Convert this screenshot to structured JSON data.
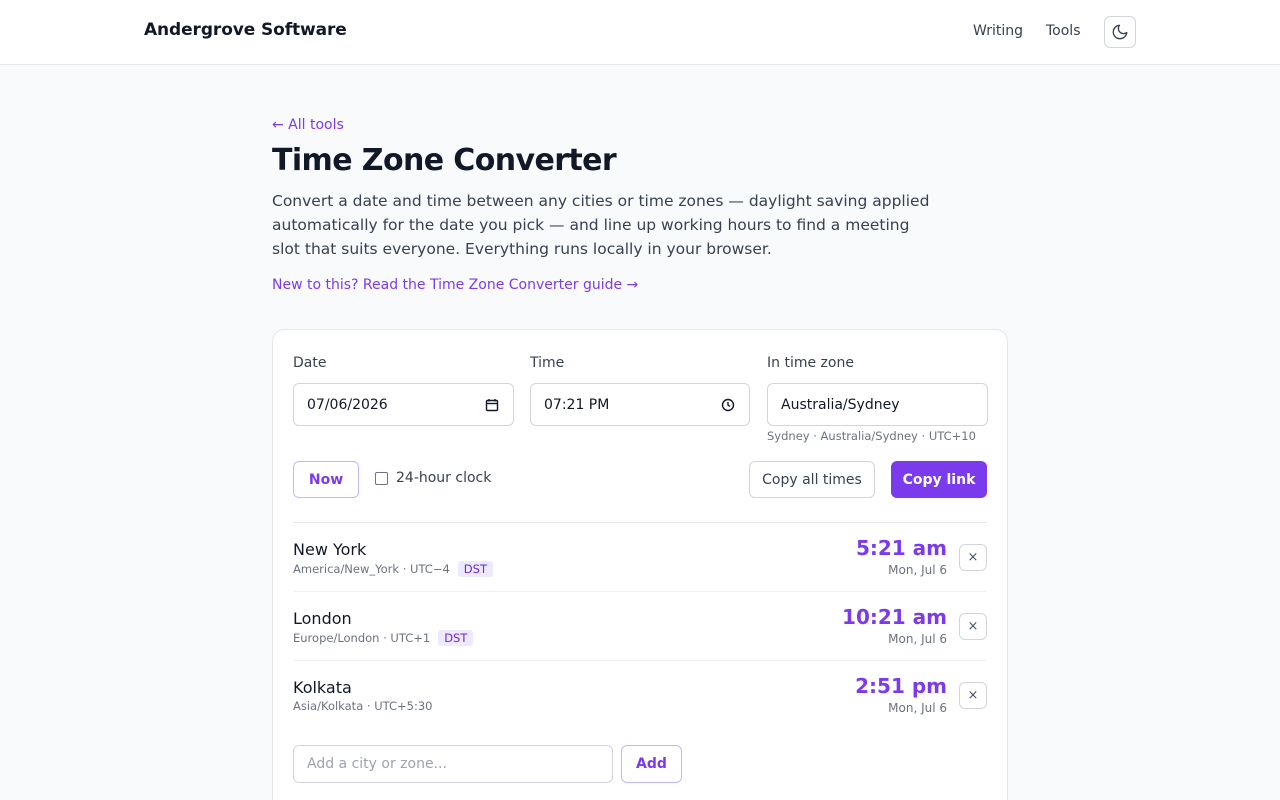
{
  "header": {
    "brand": "Andergrove Software",
    "nav": [
      {
        "label": "Writing"
      },
      {
        "label": "Tools"
      }
    ],
    "theme_icon": "moon-icon"
  },
  "page": {
    "back_link": "← All tools",
    "title": "Time Zone Converter",
    "intro": "Convert a date and time between any cities or time zones — daylight saving applied automatically for the date you pick — and line up working hours to find a meeting slot that suits everyone. Everything runs locally in your browser.",
    "guide_link": "New to this? Read the Time Zone Converter guide →"
  },
  "form": {
    "date_label": "Date",
    "date_value": "07/06/2026",
    "date_icon": "calendar-icon",
    "time_label": "Time",
    "time_value": "07:21 PM",
    "time_icon": "clock-icon",
    "zone_label": "In time zone",
    "zone_value": "Australia/Sydney",
    "zone_hint": "Sydney · Australia/Sydney · UTC+10",
    "now_label": "Now",
    "clock24_label": "24-hour clock",
    "clock24_checked": false,
    "copy_all_label": "Copy all times",
    "copy_link_label": "Copy link"
  },
  "zones": [
    {
      "city": "New York",
      "meta": "America/New_York · UTC−4",
      "dst": "DST",
      "time": "5:21 am",
      "day": "Mon, Jul 6"
    },
    {
      "city": "London",
      "meta": "Europe/London · UTC+1",
      "dst": "DST",
      "time": "10:21 am",
      "day": "Mon, Jul 6"
    },
    {
      "city": "Kolkata",
      "meta": "Asia/Kolkata · UTC+5:30",
      "dst": "",
      "time": "2:51 pm",
      "day": "Mon, Jul 6"
    }
  ],
  "remove_label": "×",
  "add": {
    "placeholder": "Add a city or zone...",
    "button_label": "Add"
  },
  "colors": {
    "accent": "#7c3aed",
    "dst_bg": "#ede9fe"
  }
}
